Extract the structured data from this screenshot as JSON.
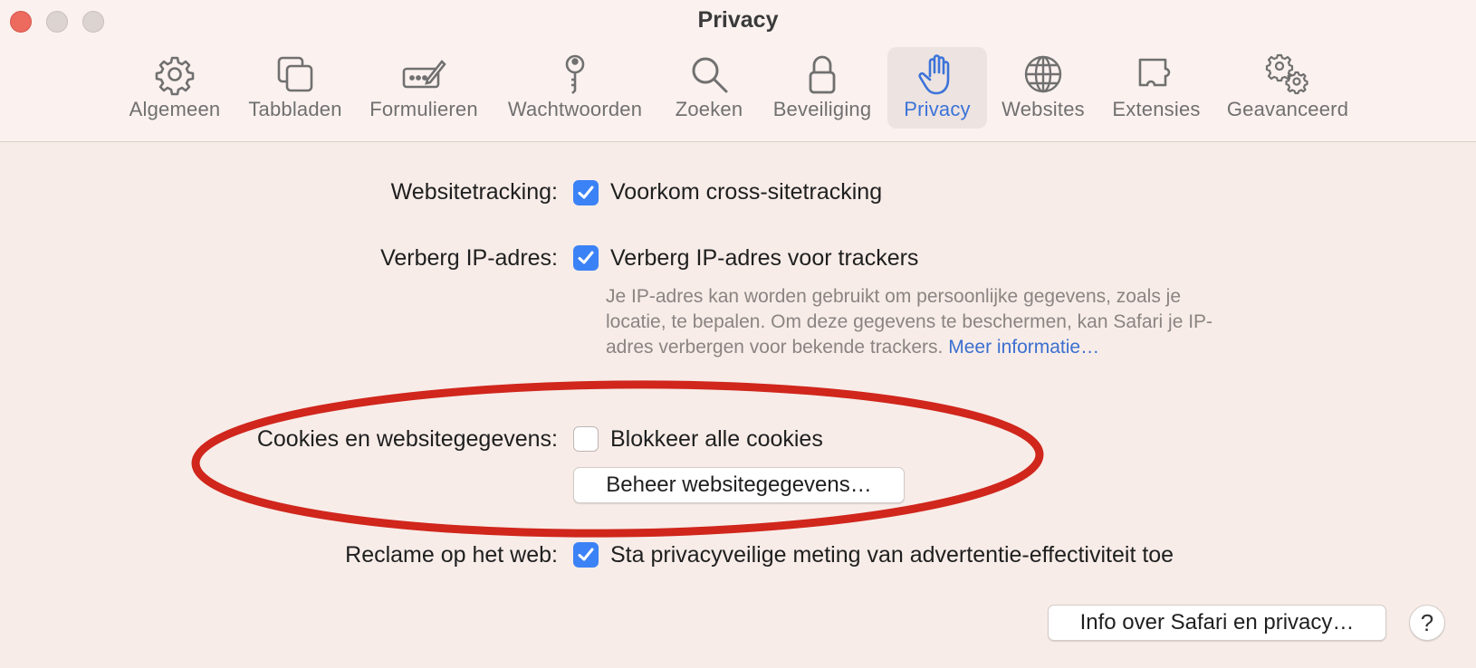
{
  "window": {
    "title": "Privacy"
  },
  "toolbar": {
    "tabs": [
      {
        "label": "Algemeen",
        "icon": "gear-icon"
      },
      {
        "label": "Tabbladen",
        "icon": "tabs-icon"
      },
      {
        "label": "Formulieren",
        "icon": "form-pencil-icon"
      },
      {
        "label": "Wachtwoorden",
        "icon": "key-icon"
      },
      {
        "label": "Zoeken",
        "icon": "search-icon"
      },
      {
        "label": "Beveiliging",
        "icon": "lock-icon"
      },
      {
        "label": "Privacy",
        "icon": "hand-icon",
        "active": true
      },
      {
        "label": "Websites",
        "icon": "globe-icon"
      },
      {
        "label": "Extensies",
        "icon": "puzzle-icon"
      },
      {
        "label": "Geavanceerd",
        "icon": "gears-icon"
      }
    ]
  },
  "settings": {
    "tracking": {
      "label": "Websitetracking:",
      "option": "Voorkom cross-sitetracking",
      "checked": true
    },
    "hide_ip": {
      "label": "Verberg IP-adres:",
      "option": "Verberg IP-adres voor trackers",
      "checked": true,
      "description": "Je IP-adres kan worden gebruikt om persoonlijke gegevens, zoals je locatie, te bepalen. Om deze gegevens te beschermen, kan Safari je IP-adres verbergen voor bekende trackers.",
      "link": "Meer informatie…"
    },
    "cookies": {
      "label": "Cookies en websitegegevens:",
      "option": "Blokkeer alle cookies",
      "checked": false,
      "manage_button": "Beheer websitegegevens…"
    },
    "ads": {
      "label": "Reclame op het web:",
      "option": "Sta privacyveilige meting van advertentie-effectiviteit toe",
      "checked": true
    }
  },
  "footer": {
    "info_button": "Info over Safari en privacy…",
    "help_button": "?"
  },
  "colors": {
    "accent": "#3b82f6",
    "annotation": "#d0261c",
    "background": "#f7ece8"
  }
}
